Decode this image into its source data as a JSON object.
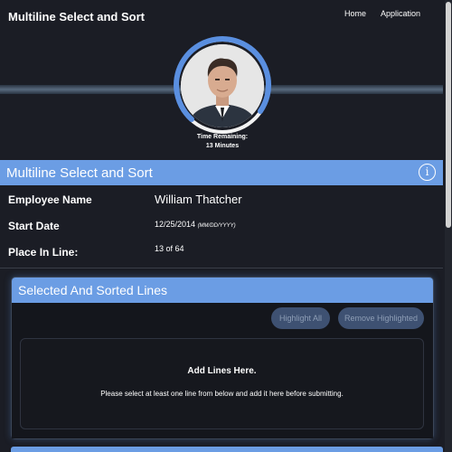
{
  "app": {
    "title": "Multiline Select and Sort",
    "nav": [
      "Home",
      "Application"
    ]
  },
  "timer": {
    "label": "Time Remaining:",
    "value": "13 Minutes",
    "ring_color": "#5a8fe0"
  },
  "main": {
    "header": "Multiline Select and Sort",
    "info_icon": "info-icon",
    "fields": [
      {
        "label": "Employee Name",
        "value": "William Thatcher"
      },
      {
        "label": "Start Date",
        "value": "12/25/2014",
        "format": "(MM/DD/YYYY)"
      },
      {
        "label": "Place In Line:",
        "value": "13 of 64"
      }
    ]
  },
  "selected_panel": {
    "title": "Selected And Sorted Lines",
    "highlight_all": "Highlight All",
    "remove_highlighted": "Remove Highlighted",
    "drop_title": "Add Lines Here.",
    "drop_text": "Please select at least one line from below and add it here before submitting."
  },
  "colors": {
    "accent": "#6b9de4",
    "background": "#1b1d25"
  }
}
